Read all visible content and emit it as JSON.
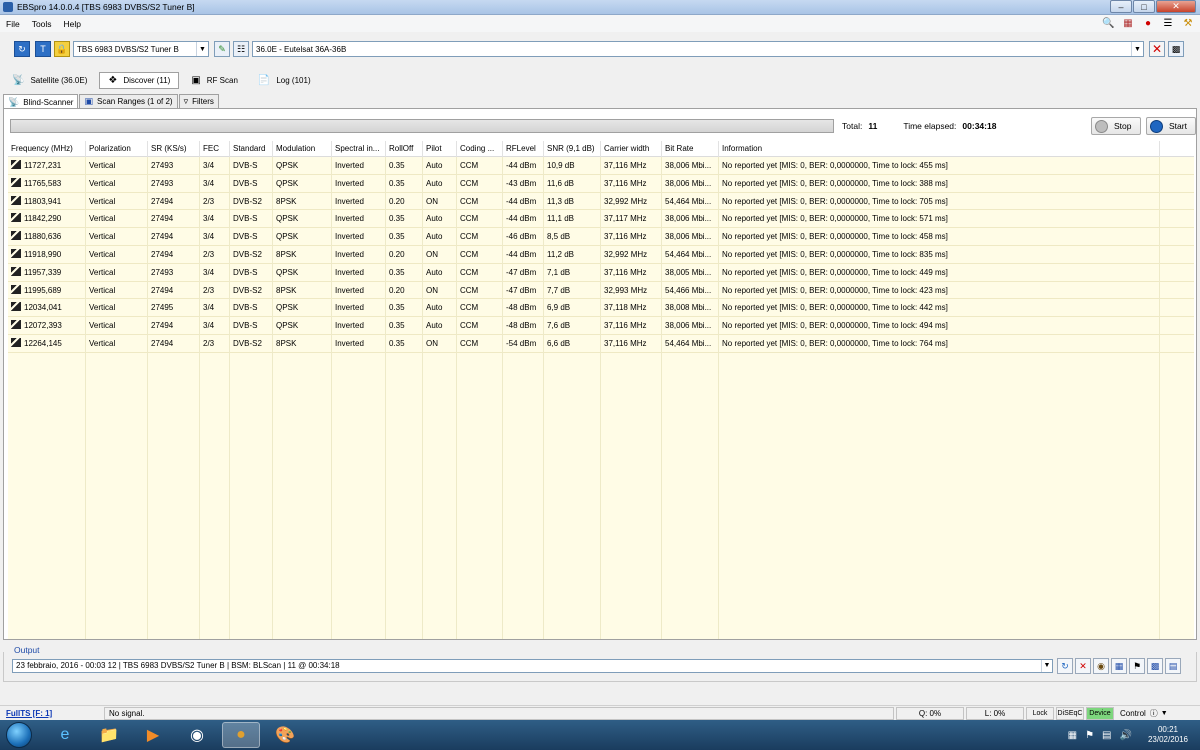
{
  "window": {
    "title": "EBSpro 14.0.0.4 [TBS 6983 DVBS/S2 Tuner B]"
  },
  "menu": [
    "File",
    "Tools",
    "Help"
  ],
  "toolbar": {
    "tuner": "TBS 6983 DVBS/S2 Tuner B",
    "satellite": "36.0E - Eutelsat 36A-36B"
  },
  "main_tabs": [
    {
      "label": "Satellite (36.0E)",
      "icon": "satellite-dish-icon"
    },
    {
      "label": "Discover (11)",
      "icon": "discover-icon",
      "active": true
    },
    {
      "label": "RF Scan",
      "icon": "rf-scan-icon"
    },
    {
      "label": "Log (101)",
      "icon": "log-icon"
    }
  ],
  "sub_tabs": [
    {
      "label": "Blind-Scanner",
      "active": true
    },
    {
      "label": "Scan Ranges (1 of 2)"
    },
    {
      "label": "Filters"
    }
  ],
  "scan": {
    "total_label": "Total:",
    "total_value": "11",
    "elapsed_label": "Time elapsed:",
    "elapsed_value": "00:34:18",
    "stop_label": "Stop",
    "start_label": "Start"
  },
  "table": {
    "columns": [
      "Frequency (MHz)",
      "Polarization",
      "SR (KS/s)",
      "FEC",
      "Standard",
      "Modulation",
      "Spectral in...",
      "RollOff",
      "Pilot",
      "Coding ...",
      "RFLevel",
      "SNR (9,1 dB)",
      "Carrier width",
      "Bit Rate",
      "Information"
    ],
    "rows": [
      [
        "11727,231",
        "Vertical",
        "27493",
        "3/4",
        "DVB-S",
        "QPSK",
        "Inverted",
        "0.35",
        "Auto",
        "CCM",
        "-44 dBm",
        "10,9 dB",
        "37,116 MHz",
        "38,006 Mbi...",
        "No reported yet [MIS: 0, BER: 0,0000000, Time to lock: 455 ms]"
      ],
      [
        "11765,583",
        "Vertical",
        "27493",
        "3/4",
        "DVB-S",
        "QPSK",
        "Inverted",
        "0.35",
        "Auto",
        "CCM",
        "-43 dBm",
        "11,6 dB",
        "37,116 MHz",
        "38,006 Mbi...",
        "No reported yet [MIS: 0, BER: 0,0000000, Time to lock: 388 ms]"
      ],
      [
        "11803,941",
        "Vertical",
        "27494",
        "2/3",
        "DVB-S2",
        "8PSK",
        "Inverted",
        "0.20",
        "ON",
        "CCM",
        "-44 dBm",
        "11,3 dB",
        "32,992 MHz",
        "54,464 Mbi...",
        "No reported yet [MIS: 0, BER: 0,0000000, Time to lock: 705 ms]"
      ],
      [
        "11842,290",
        "Vertical",
        "27494",
        "3/4",
        "DVB-S",
        "QPSK",
        "Inverted",
        "0.35",
        "Auto",
        "CCM",
        "-44 dBm",
        "11,1 dB",
        "37,117 MHz",
        "38,006 Mbi...",
        "No reported yet [MIS: 0, BER: 0,0000000, Time to lock: 571 ms]"
      ],
      [
        "11880,636",
        "Vertical",
        "27494",
        "3/4",
        "DVB-S",
        "QPSK",
        "Inverted",
        "0.35",
        "Auto",
        "CCM",
        "-46 dBm",
        "8,5 dB",
        "37,116 MHz",
        "38,006 Mbi...",
        "No reported yet [MIS: 0, BER: 0,0000000, Time to lock: 458 ms]"
      ],
      [
        "11918,990",
        "Vertical",
        "27494",
        "2/3",
        "DVB-S2",
        "8PSK",
        "Inverted",
        "0.20",
        "ON",
        "CCM",
        "-44 dBm",
        "11,2 dB",
        "32,992 MHz",
        "54,464 Mbi...",
        "No reported yet [MIS: 0, BER: 0,0000000, Time to lock: 835 ms]"
      ],
      [
        "11957,339",
        "Vertical",
        "27493",
        "3/4",
        "DVB-S",
        "QPSK",
        "Inverted",
        "0.35",
        "Auto",
        "CCM",
        "-47 dBm",
        "7,1 dB",
        "37,116 MHz",
        "38,005 Mbi...",
        "No reported yet [MIS: 0, BER: 0,0000000, Time to lock: 449 ms]"
      ],
      [
        "11995,689",
        "Vertical",
        "27494",
        "2/3",
        "DVB-S2",
        "8PSK",
        "Inverted",
        "0.20",
        "ON",
        "CCM",
        "-47 dBm",
        "7,7 dB",
        "32,993 MHz",
        "54,466 Mbi...",
        "No reported yet [MIS: 0, BER: 0,0000000, Time to lock: 423 ms]"
      ],
      [
        "12034,041",
        "Vertical",
        "27495",
        "3/4",
        "DVB-S",
        "QPSK",
        "Inverted",
        "0.35",
        "Auto",
        "CCM",
        "-48 dBm",
        "6,9 dB",
        "37,118 MHz",
        "38,008 Mbi...",
        "No reported yet [MIS: 0, BER: 0,0000000, Time to lock: 442 ms]"
      ],
      [
        "12072,393",
        "Vertical",
        "27494",
        "3/4",
        "DVB-S",
        "QPSK",
        "Inverted",
        "0.35",
        "Auto",
        "CCM",
        "-48 dBm",
        "7,6 dB",
        "37,116 MHz",
        "38,006 Mbi...",
        "No reported yet [MIS: 0, BER: 0,0000000, Time to lock: 494 ms]"
      ],
      [
        "12264,145",
        "Vertical",
        "27494",
        "2/3",
        "DVB-S2",
        "8PSK",
        "Inverted",
        "0.35",
        "ON",
        "CCM",
        "-54 dBm",
        "6,6 dB",
        "37,116 MHz",
        "54,464 Mbi...",
        "No reported yet [MIS: 0, BER: 0,0000000, Time to lock: 764 ms]"
      ]
    ]
  },
  "output": {
    "label": "Output",
    "value": "23 febbraio, 2016 - 00:03 12 | TBS 6983 DVBS/S2 Tuner B | BSM: BLScan | 11 @ 00:34:18"
  },
  "status": {
    "fullts": "FullTS [F: 1]",
    "signal": "No signal.",
    "q": "Q: 0%",
    "l": "L: 0%",
    "lock": "Lock",
    "diseqc": "DiSEqC",
    "device": "Device",
    "control": "Control",
    "device_color": "#7dd67d"
  },
  "taskbar": {
    "time": "00:21",
    "date": "23/02/2016"
  }
}
